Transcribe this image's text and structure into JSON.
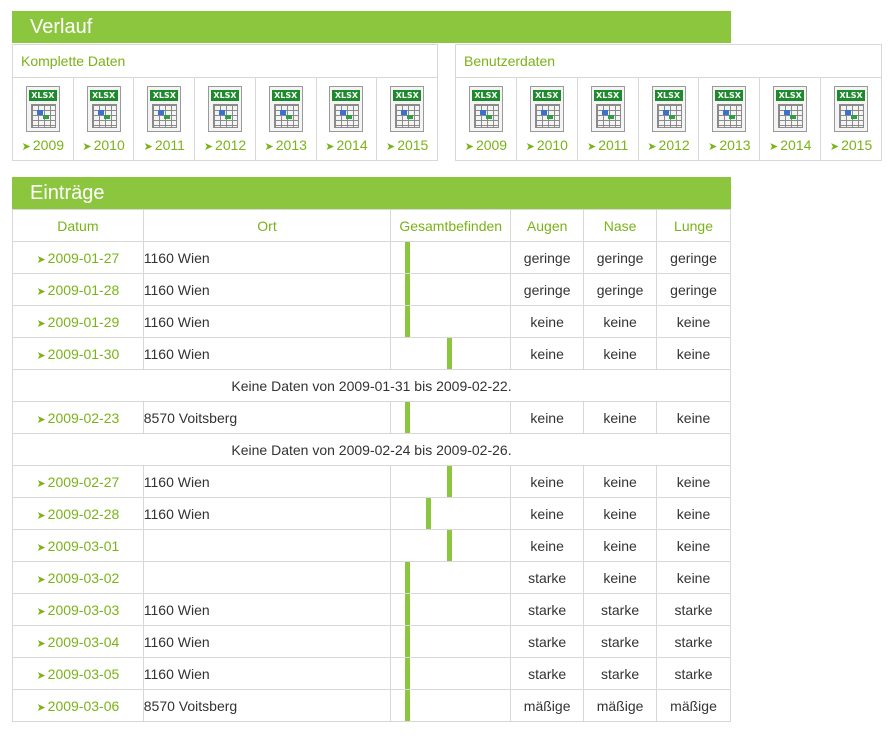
{
  "verlauf": {
    "title": "Verlauf",
    "complete": {
      "label": "Komplette Daten",
      "years": [
        "2009",
        "2010",
        "2011",
        "2012",
        "2013",
        "2014",
        "2015"
      ]
    },
    "user": {
      "label": "Benutzerdaten",
      "years": [
        "2009",
        "2010",
        "2011",
        "2012",
        "2013",
        "2014",
        "2015"
      ]
    },
    "file_badge": "XLSX"
  },
  "entries": {
    "title": "Einträge",
    "columns": [
      "Datum",
      "Ort",
      "Gesamtbefinden",
      "Augen",
      "Nase",
      "Lunge"
    ],
    "accent_color": "#8cc63f",
    "rows": [
      {
        "type": "entry",
        "date": "2009-01-27",
        "place": "1160 Wien",
        "wellbeing": 2,
        "eyes": "geringe",
        "nose": "geringe",
        "lungs": "geringe"
      },
      {
        "type": "entry",
        "date": "2009-01-28",
        "place": "1160 Wien",
        "wellbeing": 2,
        "eyes": "geringe",
        "nose": "geringe",
        "lungs": "geringe"
      },
      {
        "type": "entry",
        "date": "2009-01-29",
        "place": "1160 Wien",
        "wellbeing": 2,
        "eyes": "keine",
        "nose": "keine",
        "lungs": "keine"
      },
      {
        "type": "entry",
        "date": "2009-01-30",
        "place": "1160 Wien",
        "wellbeing": 4,
        "eyes": "keine",
        "nose": "keine",
        "lungs": "keine"
      },
      {
        "type": "gap",
        "text": "Keine Daten von 2009-01-31 bis 2009-02-22."
      },
      {
        "type": "entry",
        "date": "2009-02-23",
        "place": "8570 Voitsberg",
        "wellbeing": 2,
        "eyes": "keine",
        "nose": "keine",
        "lungs": "keine"
      },
      {
        "type": "gap",
        "text": "Keine Daten von 2009-02-24 bis 2009-02-26."
      },
      {
        "type": "entry",
        "date": "2009-02-27",
        "place": "1160 Wien",
        "wellbeing": 4,
        "eyes": "keine",
        "nose": "keine",
        "lungs": "keine"
      },
      {
        "type": "entry",
        "date": "2009-02-28",
        "place": "1160 Wien",
        "wellbeing": 3,
        "eyes": "keine",
        "nose": "keine",
        "lungs": "keine"
      },
      {
        "type": "entry",
        "date": "2009-03-01",
        "place": "",
        "wellbeing": 4,
        "eyes": "keine",
        "nose": "keine",
        "lungs": "keine"
      },
      {
        "type": "entry",
        "date": "2009-03-02",
        "place": "",
        "wellbeing": 2,
        "eyes": "starke",
        "nose": "keine",
        "lungs": "keine"
      },
      {
        "type": "entry",
        "date": "2009-03-03",
        "place": "1160 Wien",
        "wellbeing": 2,
        "eyes": "starke",
        "nose": "starke",
        "lungs": "starke"
      },
      {
        "type": "entry",
        "date": "2009-03-04",
        "place": "1160 Wien",
        "wellbeing": 2,
        "eyes": "starke",
        "nose": "starke",
        "lungs": "starke"
      },
      {
        "type": "entry",
        "date": "2009-03-05",
        "place": "1160 Wien",
        "wellbeing": 2,
        "eyes": "starke",
        "nose": "starke",
        "lungs": "starke"
      },
      {
        "type": "entry",
        "date": "2009-03-06",
        "place": "8570 Voitsberg",
        "wellbeing": 2,
        "eyes": "mäßige",
        "nose": "mäßige",
        "lungs": "mäßige"
      }
    ]
  }
}
